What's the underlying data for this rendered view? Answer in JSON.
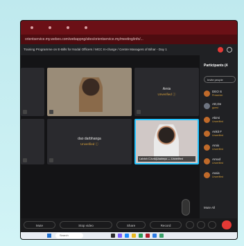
{
  "browser": {
    "address": "orientservice.my.webex.com/webappng/sites/orientservice.my/meeting/info/...",
    "meeting_title": "Training Programme on E-Bills for Nodal Officers / MCC In-charge / Centre Managers of Bihar - Day 1"
  },
  "tiles": [
    {
      "name": "",
      "status": ""
    },
    {
      "name": "",
      "status": ""
    },
    {
      "name": "Arnis",
      "status": "Unverified ⓘ"
    },
    {
      "name": "",
      "status": ""
    },
    {
      "name": "dao darbhanga",
      "status": "Unverified ⓘ"
    },
    {
      "name": "",
      "status": "",
      "nametag": "Lalvish CJunk(Uaaheyo — Unverified"
    }
  ],
  "participants": {
    "title": "Participants (4",
    "invite_label": "Invite people",
    "items": [
      {
        "name": "DEO S",
        "sub": "Presenter"
      },
      {
        "name": "AD,De",
        "sub": "guest"
      },
      {
        "name": "Akimi",
        "sub": "Unverified"
      },
      {
        "name": "Ankit F",
        "sub": "Unverified"
      },
      {
        "name": "Arnis",
        "sub": "Unverified"
      },
      {
        "name": "Arnod",
        "sub": "Unverified"
      },
      {
        "name": "Assis",
        "sub": "Unverified"
      }
    ],
    "mute_all": "Mute All"
  },
  "toolbar": {
    "mute": "Mute",
    "stop_video": "Stop video",
    "share": "Share",
    "record": "Record"
  },
  "taskbar": {
    "search_placeholder": "Search"
  }
}
